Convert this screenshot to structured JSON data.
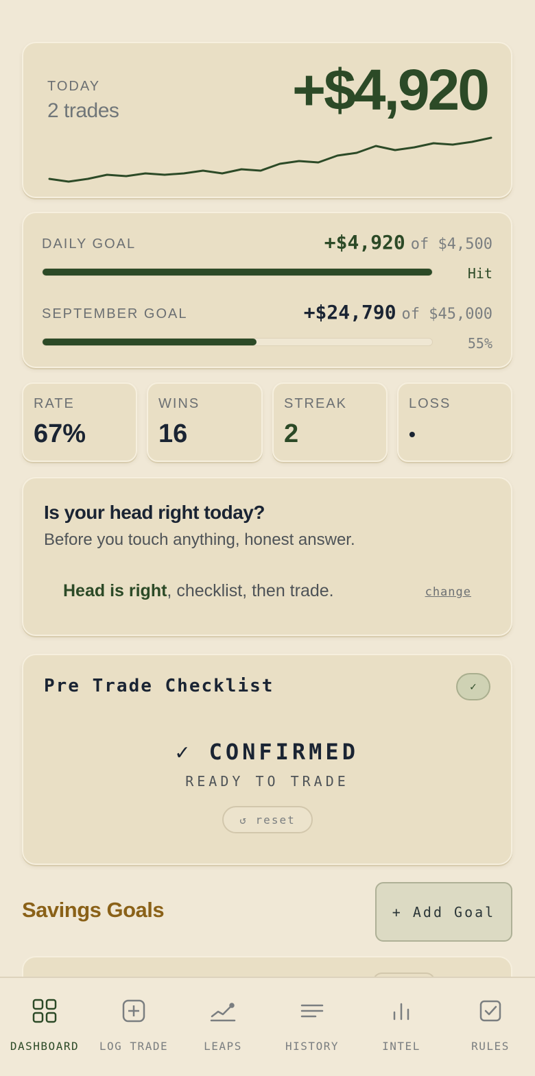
{
  "today": {
    "label": "TODAY",
    "trades": "2 trades",
    "amount": "+$4,920",
    "sparkline": [
      5,
      3,
      5,
      8,
      7,
      9,
      8,
      9,
      11,
      9,
      12,
      11,
      16,
      18,
      17,
      22,
      24,
      29,
      26,
      28,
      31,
      30,
      32,
      35
    ]
  },
  "goals": {
    "daily": {
      "label": "DAILY GOAL",
      "amount": "+$4,920",
      "of": "of $4,500",
      "status": "Hit",
      "progress": 1.0
    },
    "monthly": {
      "label": "SEPTEMBER GOAL",
      "amount": "+$24,790",
      "of": "of $45,000",
      "status": "55%",
      "progress": 0.55
    }
  },
  "stats": [
    {
      "label": "RATE",
      "value": "67%"
    },
    {
      "label": "WINS",
      "value": "16"
    },
    {
      "label": "STREAK",
      "value": "2"
    },
    {
      "label": "LOSS",
      "value": "•"
    }
  ],
  "head": {
    "title": "Is your head right today?",
    "subtitle": "Before you touch anything, honest answer.",
    "status_strong": "Head is right",
    "status_rest": ", checklist, then trade.",
    "change_label": "change"
  },
  "checklist": {
    "title": "Pre Trade Checklist",
    "toggle": "✓",
    "confirmed": "✓ CONFIRMED",
    "ready": "READY TO TRADE",
    "reset": "↺ reset"
  },
  "savings": {
    "title": "Savings Goals",
    "add_label": "+ Add Goal"
  },
  "nav": [
    {
      "label": "DASHBOARD",
      "icon": "grid-icon",
      "active": true
    },
    {
      "label": "LOG TRADE",
      "icon": "plus-square-icon",
      "active": false
    },
    {
      "label": "LEAPS",
      "icon": "trend-line-icon",
      "active": false
    },
    {
      "label": "HISTORY",
      "icon": "list-icon",
      "active": false
    },
    {
      "label": "INTEL",
      "icon": "bar-chart-icon",
      "active": false
    },
    {
      "label": "RULES",
      "icon": "checkbox-icon",
      "active": false
    }
  ],
  "colors": {
    "accent": "#2c4a27",
    "gold": "#8a6118",
    "background": "#f0e8d6",
    "card": "#e9dfc5"
  }
}
